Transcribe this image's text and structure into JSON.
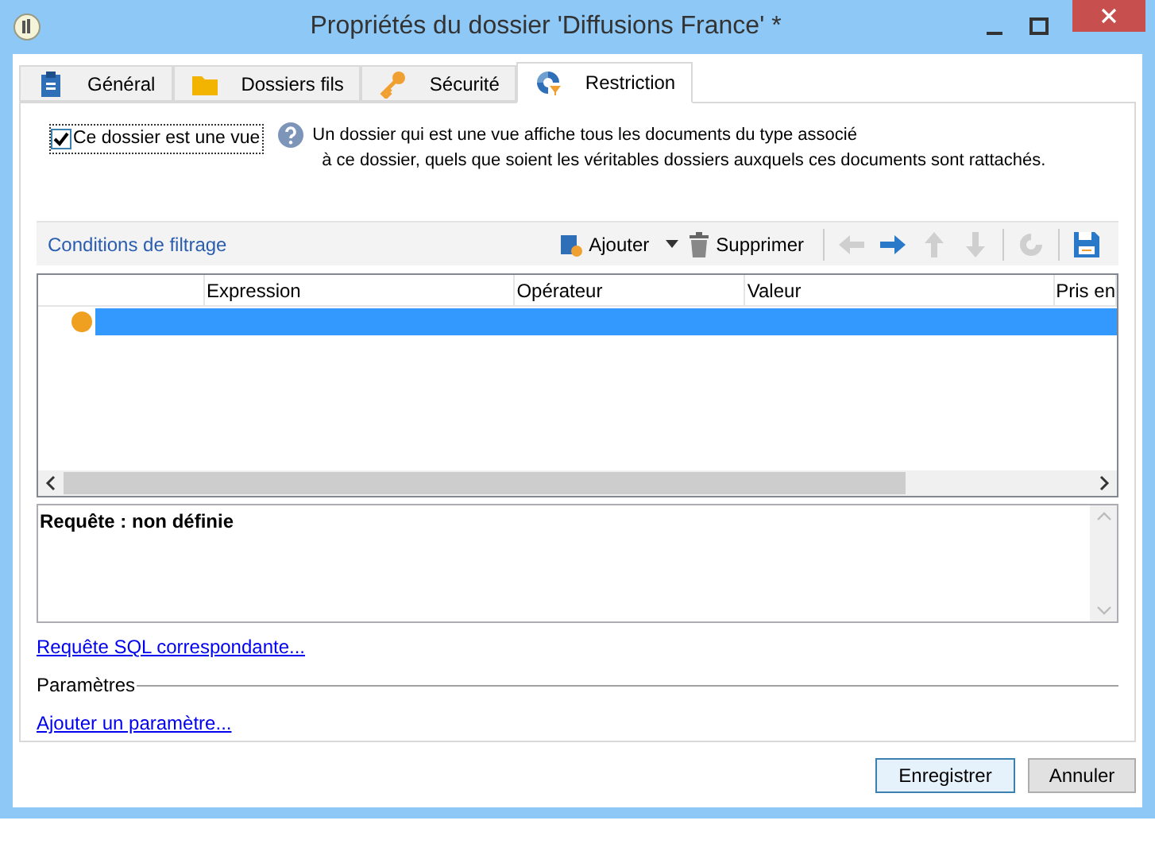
{
  "window": {
    "title": "Propriétés du dossier 'Diffusions France' *"
  },
  "tabs": [
    {
      "label": "Général",
      "selected": false
    },
    {
      "label": "Dossiers fils",
      "selected": false
    },
    {
      "label": "Sécurité",
      "selected": false
    },
    {
      "label": "Restriction",
      "selected": true
    }
  ],
  "view_checkbox": {
    "label": "Ce dossier est une vue",
    "checked": true
  },
  "help_text": [
    "Un dossier qui est une vue affiche tous les documents du type associé",
    "à ce dossier, quels que soient les véritables dossiers auxquels ces documents sont rattachés."
  ],
  "filter_toolbar": {
    "title": "Conditions de filtrage",
    "add": "Ajouter",
    "delete": "Supprimer",
    "tools": [
      {
        "kind": "left",
        "disabled": true
      },
      {
        "kind": "right",
        "disabled": false
      },
      {
        "kind": "up",
        "disabled": true
      },
      {
        "kind": "down",
        "disabled": true
      },
      {
        "kind": "refresh",
        "disabled": true
      },
      {
        "kind": "save",
        "disabled": false
      }
    ]
  },
  "table": {
    "columns": [
      "Expression",
      "Opérateur",
      "Valeur",
      "Pris en"
    ],
    "rows": [
      {
        "selected": true
      }
    ]
  },
  "query": "Requête : non définie",
  "sql_link": "Requête SQL correspondante...",
  "parameters": {
    "title": "Paramètres",
    "add_link": "Ajouter un paramètre..."
  },
  "buttons": [
    "Enregistrer",
    "Annuler"
  ]
}
